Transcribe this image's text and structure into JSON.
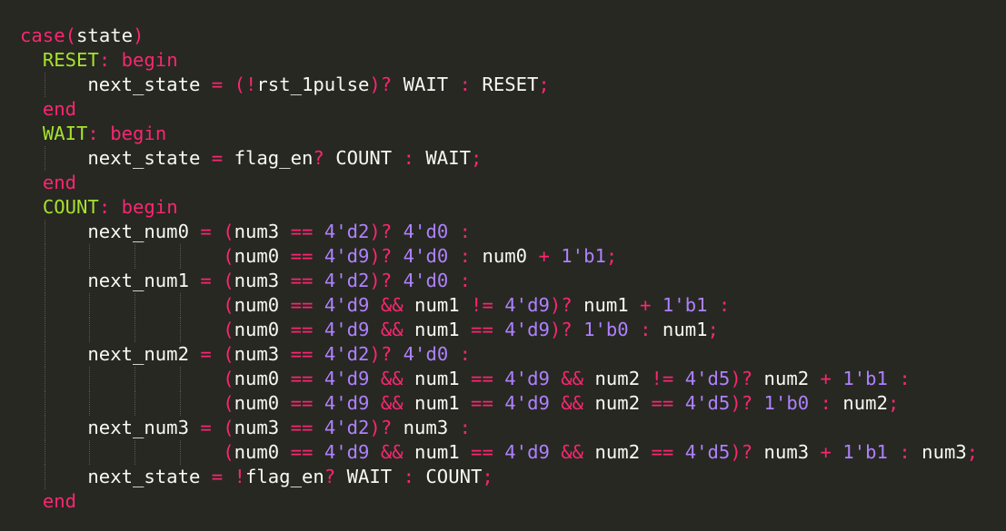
{
  "editor": {
    "language": "verilog",
    "colors": {
      "background": "#272822",
      "plain": "#f8f8f2",
      "keyword": "#f92672",
      "number": "#ae81ff",
      "label": "#a6e22e",
      "guide": "#5a5a50"
    },
    "lines": [
      {
        "tokens": [
          [
            "keyword",
            "case"
          ],
          [
            "keyword",
            "("
          ],
          [
            "plain",
            "state"
          ],
          [
            "keyword",
            ")"
          ]
        ]
      },
      {
        "tokens": [
          [
            "plain",
            "  "
          ],
          [
            "label",
            "RESET"
          ],
          [
            "keyword",
            ": begin"
          ]
        ]
      },
      {
        "tokens": [
          [
            "plain",
            "      next_state "
          ],
          [
            "keyword",
            "= ("
          ],
          [
            "keyword",
            "!"
          ],
          [
            "plain",
            "rst_1pulse"
          ],
          [
            "keyword",
            ")?"
          ],
          [
            "plain",
            " WAIT "
          ],
          [
            "keyword",
            ":"
          ],
          [
            "plain",
            " RESET"
          ],
          [
            "keyword",
            ";"
          ]
        ]
      },
      {
        "tokens": [
          [
            "plain",
            "  "
          ],
          [
            "keyword",
            "end"
          ]
        ]
      },
      {
        "tokens": [
          [
            "plain",
            "  "
          ],
          [
            "label",
            "WAIT"
          ],
          [
            "keyword",
            ": begin"
          ]
        ]
      },
      {
        "tokens": [
          [
            "plain",
            "      next_state "
          ],
          [
            "keyword",
            "="
          ],
          [
            "plain",
            " flag_en"
          ],
          [
            "keyword",
            "?"
          ],
          [
            "plain",
            " COUNT "
          ],
          [
            "keyword",
            ":"
          ],
          [
            "plain",
            " WAIT"
          ],
          [
            "keyword",
            ";"
          ]
        ]
      },
      {
        "tokens": [
          [
            "plain",
            "  "
          ],
          [
            "keyword",
            "end"
          ]
        ]
      },
      {
        "tokens": [
          [
            "plain",
            "  "
          ],
          [
            "label",
            "COUNT"
          ],
          [
            "keyword",
            ": begin"
          ]
        ]
      },
      {
        "tokens": [
          [
            "plain",
            "      next_num0 "
          ],
          [
            "keyword",
            "= ("
          ],
          [
            "plain",
            "num3 "
          ],
          [
            "keyword",
            "=="
          ],
          [
            "plain",
            " "
          ],
          [
            "number",
            "4'd2"
          ],
          [
            "keyword",
            ")?"
          ],
          [
            "plain",
            " "
          ],
          [
            "number",
            "4'd0"
          ],
          [
            "plain",
            " "
          ],
          [
            "keyword",
            ":"
          ]
        ]
      },
      {
        "tokens": [
          [
            "plain",
            "                  "
          ],
          [
            "keyword",
            "("
          ],
          [
            "plain",
            "num0 "
          ],
          [
            "keyword",
            "=="
          ],
          [
            "plain",
            " "
          ],
          [
            "number",
            "4'd9"
          ],
          [
            "keyword",
            ")?"
          ],
          [
            "plain",
            " "
          ],
          [
            "number",
            "4'd0"
          ],
          [
            "plain",
            " "
          ],
          [
            "keyword",
            ":"
          ],
          [
            "plain",
            " num0 "
          ],
          [
            "keyword",
            "+"
          ],
          [
            "plain",
            " "
          ],
          [
            "number",
            "1'b1"
          ],
          [
            "keyword",
            ";"
          ]
        ]
      },
      {
        "tokens": [
          [
            "plain",
            "      next_num1 "
          ],
          [
            "keyword",
            "= ("
          ],
          [
            "plain",
            "num3 "
          ],
          [
            "keyword",
            "=="
          ],
          [
            "plain",
            " "
          ],
          [
            "number",
            "4'd2"
          ],
          [
            "keyword",
            ")?"
          ],
          [
            "plain",
            " "
          ],
          [
            "number",
            "4'd0"
          ],
          [
            "plain",
            " "
          ],
          [
            "keyword",
            ":"
          ]
        ]
      },
      {
        "tokens": [
          [
            "plain",
            "                  "
          ],
          [
            "keyword",
            "("
          ],
          [
            "plain",
            "num0 "
          ],
          [
            "keyword",
            "=="
          ],
          [
            "plain",
            " "
          ],
          [
            "number",
            "4'd9"
          ],
          [
            "plain",
            " "
          ],
          [
            "keyword",
            "&&"
          ],
          [
            "plain",
            " num1 "
          ],
          [
            "keyword",
            "!="
          ],
          [
            "plain",
            " "
          ],
          [
            "number",
            "4'd9"
          ],
          [
            "keyword",
            ")?"
          ],
          [
            "plain",
            " num1 "
          ],
          [
            "keyword",
            "+"
          ],
          [
            "plain",
            " "
          ],
          [
            "number",
            "1'b1"
          ],
          [
            "plain",
            " "
          ],
          [
            "keyword",
            ":"
          ]
        ]
      },
      {
        "tokens": [
          [
            "plain",
            "                  "
          ],
          [
            "keyword",
            "("
          ],
          [
            "plain",
            "num0 "
          ],
          [
            "keyword",
            "=="
          ],
          [
            "plain",
            " "
          ],
          [
            "number",
            "4'd9"
          ],
          [
            "plain",
            " "
          ],
          [
            "keyword",
            "&&"
          ],
          [
            "plain",
            " num1 "
          ],
          [
            "keyword",
            "=="
          ],
          [
            "plain",
            " "
          ],
          [
            "number",
            "4'd9"
          ],
          [
            "keyword",
            ")?"
          ],
          [
            "plain",
            " "
          ],
          [
            "number",
            "1'b0"
          ],
          [
            "plain",
            " "
          ],
          [
            "keyword",
            ":"
          ],
          [
            "plain",
            " num1"
          ],
          [
            "keyword",
            ";"
          ]
        ]
      },
      {
        "tokens": [
          [
            "plain",
            "      next_num2 "
          ],
          [
            "keyword",
            "= ("
          ],
          [
            "plain",
            "num3 "
          ],
          [
            "keyword",
            "=="
          ],
          [
            "plain",
            " "
          ],
          [
            "number",
            "4'd2"
          ],
          [
            "keyword",
            ")?"
          ],
          [
            "plain",
            " "
          ],
          [
            "number",
            "4'd0"
          ],
          [
            "plain",
            " "
          ],
          [
            "keyword",
            ":"
          ]
        ]
      },
      {
        "tokens": [
          [
            "plain",
            "                  "
          ],
          [
            "keyword",
            "("
          ],
          [
            "plain",
            "num0 "
          ],
          [
            "keyword",
            "=="
          ],
          [
            "plain",
            " "
          ],
          [
            "number",
            "4'd9"
          ],
          [
            "plain",
            " "
          ],
          [
            "keyword",
            "&&"
          ],
          [
            "plain",
            " num1 "
          ],
          [
            "keyword",
            "=="
          ],
          [
            "plain",
            " "
          ],
          [
            "number",
            "4'd9"
          ],
          [
            "plain",
            " "
          ],
          [
            "keyword",
            "&&"
          ],
          [
            "plain",
            " num2 "
          ],
          [
            "keyword",
            "!="
          ],
          [
            "plain",
            " "
          ],
          [
            "number",
            "4'd5"
          ],
          [
            "keyword",
            ")?"
          ],
          [
            "plain",
            " num2 "
          ],
          [
            "keyword",
            "+"
          ],
          [
            "plain",
            " "
          ],
          [
            "number",
            "1'b1"
          ],
          [
            "plain",
            " "
          ],
          [
            "keyword",
            ":"
          ]
        ]
      },
      {
        "tokens": [
          [
            "plain",
            "                  "
          ],
          [
            "keyword",
            "("
          ],
          [
            "plain",
            "num0 "
          ],
          [
            "keyword",
            "=="
          ],
          [
            "plain",
            " "
          ],
          [
            "number",
            "4'd9"
          ],
          [
            "plain",
            " "
          ],
          [
            "keyword",
            "&&"
          ],
          [
            "plain",
            " num1 "
          ],
          [
            "keyword",
            "=="
          ],
          [
            "plain",
            " "
          ],
          [
            "number",
            "4'd9"
          ],
          [
            "plain",
            " "
          ],
          [
            "keyword",
            "&&"
          ],
          [
            "plain",
            " num2 "
          ],
          [
            "keyword",
            "=="
          ],
          [
            "plain",
            " "
          ],
          [
            "number",
            "4'd5"
          ],
          [
            "keyword",
            ")?"
          ],
          [
            "plain",
            " "
          ],
          [
            "number",
            "1'b0"
          ],
          [
            "plain",
            " "
          ],
          [
            "keyword",
            ":"
          ],
          [
            "plain",
            " num2"
          ],
          [
            "keyword",
            ";"
          ]
        ]
      },
      {
        "tokens": [
          [
            "plain",
            "      next_num3 "
          ],
          [
            "keyword",
            "= ("
          ],
          [
            "plain",
            "num3 "
          ],
          [
            "keyword",
            "=="
          ],
          [
            "plain",
            " "
          ],
          [
            "number",
            "4'd2"
          ],
          [
            "keyword",
            ")?"
          ],
          [
            "plain",
            " num3 "
          ],
          [
            "keyword",
            ":"
          ]
        ]
      },
      {
        "tokens": [
          [
            "plain",
            "                  "
          ],
          [
            "keyword",
            "("
          ],
          [
            "plain",
            "num0 "
          ],
          [
            "keyword",
            "=="
          ],
          [
            "plain",
            " "
          ],
          [
            "number",
            "4'd9"
          ],
          [
            "plain",
            " "
          ],
          [
            "keyword",
            "&&"
          ],
          [
            "plain",
            " num1 "
          ],
          [
            "keyword",
            "=="
          ],
          [
            "plain",
            " "
          ],
          [
            "number",
            "4'd9"
          ],
          [
            "plain",
            " "
          ],
          [
            "keyword",
            "&&"
          ],
          [
            "plain",
            " num2 "
          ],
          [
            "keyword",
            "=="
          ],
          [
            "plain",
            " "
          ],
          [
            "number",
            "4'd5"
          ],
          [
            "keyword",
            ")?"
          ],
          [
            "plain",
            " num3 "
          ],
          [
            "keyword",
            "+"
          ],
          [
            "plain",
            " "
          ],
          [
            "number",
            "1'b1"
          ],
          [
            "plain",
            " "
          ],
          [
            "keyword",
            ":"
          ],
          [
            "plain",
            " num3"
          ],
          [
            "keyword",
            ";"
          ]
        ]
      },
      {
        "tokens": [
          [
            "plain",
            "      next_state "
          ],
          [
            "keyword",
            "= !"
          ],
          [
            "plain",
            "flag_en"
          ],
          [
            "keyword",
            "?"
          ],
          [
            "plain",
            " WAIT "
          ],
          [
            "keyword",
            ":"
          ],
          [
            "plain",
            " COUNT"
          ],
          [
            "keyword",
            ";"
          ]
        ]
      },
      {
        "tokens": [
          [
            "plain",
            "  "
          ],
          [
            "keyword",
            "end"
          ]
        ]
      }
    ]
  }
}
